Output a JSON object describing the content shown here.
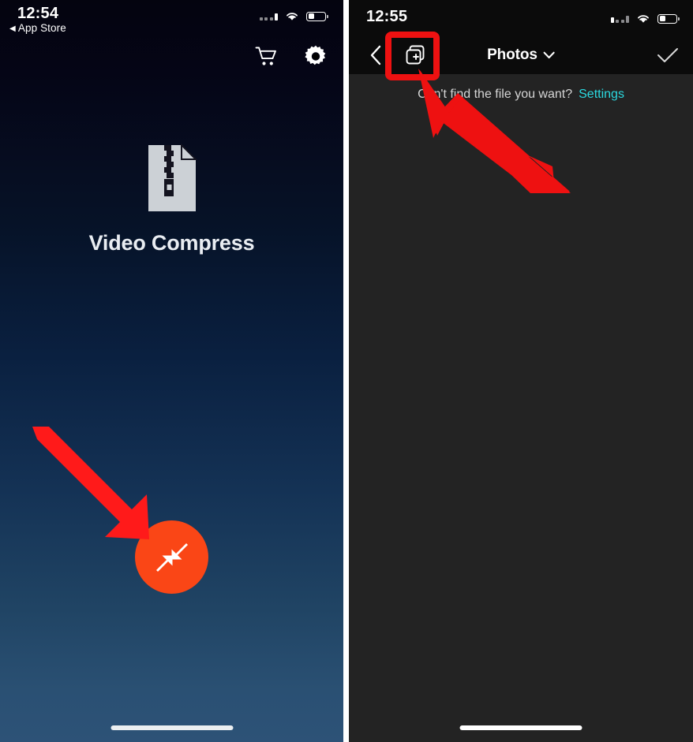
{
  "left_screen": {
    "status_bar": {
      "time": "12:54",
      "back_label": "App Store",
      "back_arrow": "◀",
      "signal_icon": "cellular-signal-icon",
      "wifi_icon": "wifi-icon",
      "battery_icon": "battery-icon",
      "battery_level_pct": 35
    },
    "toolbar": {
      "cart_icon": "shopping-cart-icon",
      "settings_icon": "gear-icon"
    },
    "app": {
      "logo_icon": "zip-file-icon",
      "title": "Video Compress"
    },
    "fab": {
      "icon": "compress-arrows-icon",
      "color": "#fa4616",
      "label": ""
    },
    "home_indicator": "home-indicator",
    "background": {
      "top_color": "#04040f",
      "bottom_color": "#2d5277"
    }
  },
  "right_screen": {
    "status_bar": {
      "time": "12:55",
      "signal_icon": "cellular-signal-icon",
      "wifi_icon": "wifi-icon",
      "battery_icon": "battery-icon",
      "battery_level_pct": 35
    },
    "nav_bar": {
      "back_icon": "chevron-left-icon",
      "multi_select_icon": "add-multiple-icon",
      "title": "Photos",
      "title_chevron": "∨",
      "confirm_icon": "checkmark-icon"
    },
    "hint": {
      "text": "Can't find the file you want?",
      "link_label": "Settings",
      "link_color": "#2bd9e0"
    },
    "home_indicator": "home-indicator",
    "background": "#232323"
  },
  "annotations": {
    "color": "#ff1a1a",
    "arrow_left_label": "arrow-pointing-to-compress-button",
    "arrow_right_label": "arrow-pointing-to-multi-select-button",
    "highlight_box_label": "highlight-box-multi-select-button"
  }
}
